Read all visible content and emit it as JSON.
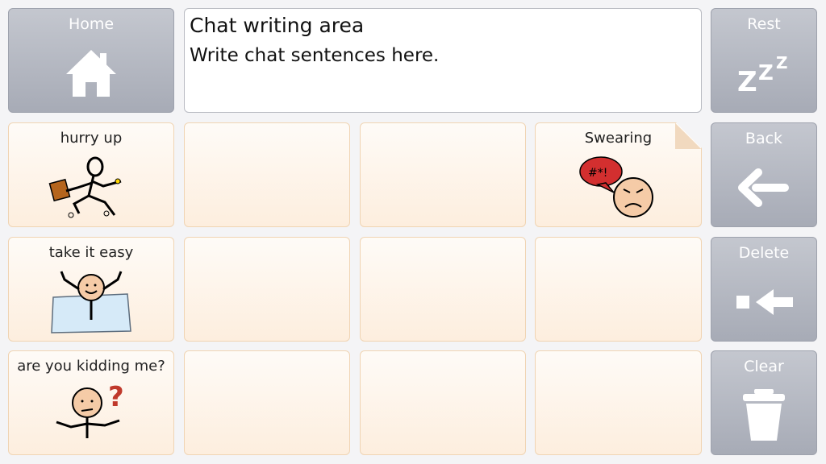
{
  "left_buttons": {
    "home_label": "Home"
  },
  "chat": {
    "title": "Chat writing area",
    "placeholder": "Write chat sentences here."
  },
  "right_buttons": {
    "rest_label": "Rest",
    "back_label": "Back",
    "delete_label": "Delete",
    "clear_label": "Clear"
  },
  "grid": {
    "hurry_up": "hurry up",
    "swearing": "Swearing",
    "take_it_easy": "take it easy",
    "kidding": "are you kidding me?"
  }
}
